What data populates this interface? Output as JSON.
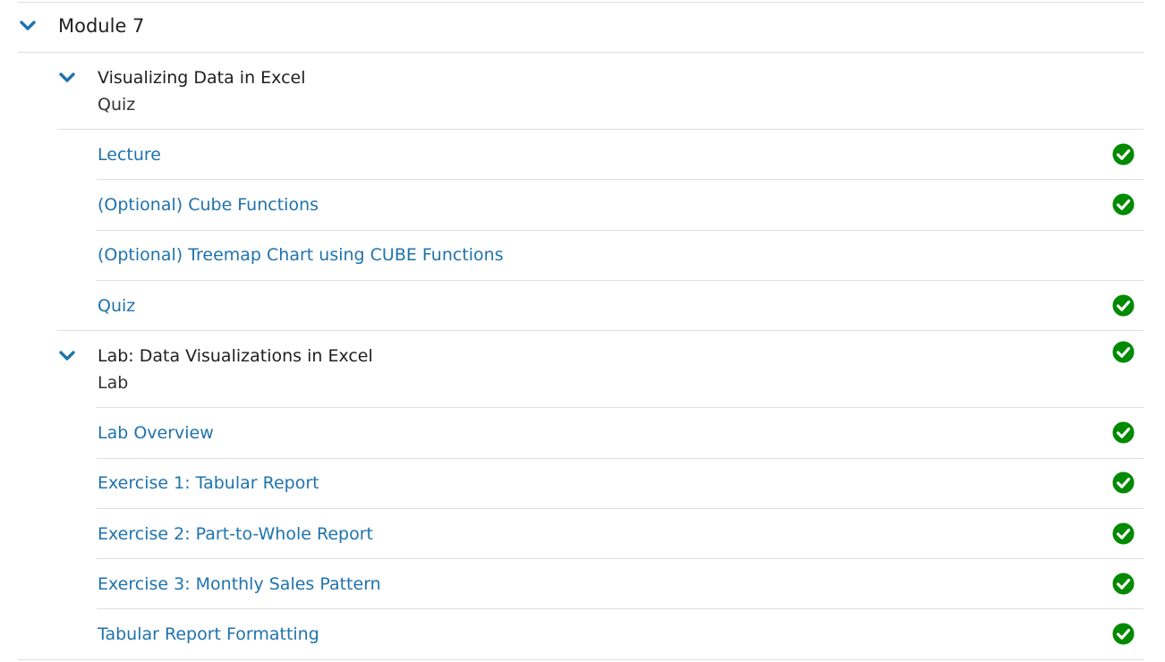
{
  "module": {
    "title": "Module 7"
  },
  "sections": [
    {
      "title": "Visualizing Data in Excel",
      "type": "Quiz",
      "completed": false,
      "items": [
        {
          "label": "Lecture",
          "completed": true
        },
        {
          "label": "(Optional) Cube Functions",
          "completed": true
        },
        {
          "label": "(Optional) Treemap Chart using CUBE Functions",
          "completed": false
        },
        {
          "label": "Quiz",
          "completed": true
        }
      ]
    },
    {
      "title": "Lab: Data Visualizations in Excel",
      "type": "Lab",
      "completed": true,
      "items": [
        {
          "label": "Lab Overview",
          "completed": true
        },
        {
          "label": "Exercise 1: Tabular Report",
          "completed": true
        },
        {
          "label": "Exercise 2: Part-to-Whole Report",
          "completed": true
        },
        {
          "label": "Exercise 3: Monthly Sales Pattern",
          "completed": true
        },
        {
          "label": "Tabular Report Formatting",
          "completed": true
        }
      ]
    }
  ],
  "icons": {
    "expand": "chevron-down-icon",
    "complete": "check-circle-icon"
  },
  "colors": {
    "link": "#1f73ac",
    "chevron": "#1f73ac",
    "complete": "#008a00",
    "divider": "#dedede",
    "text": "#1f1f1f"
  }
}
